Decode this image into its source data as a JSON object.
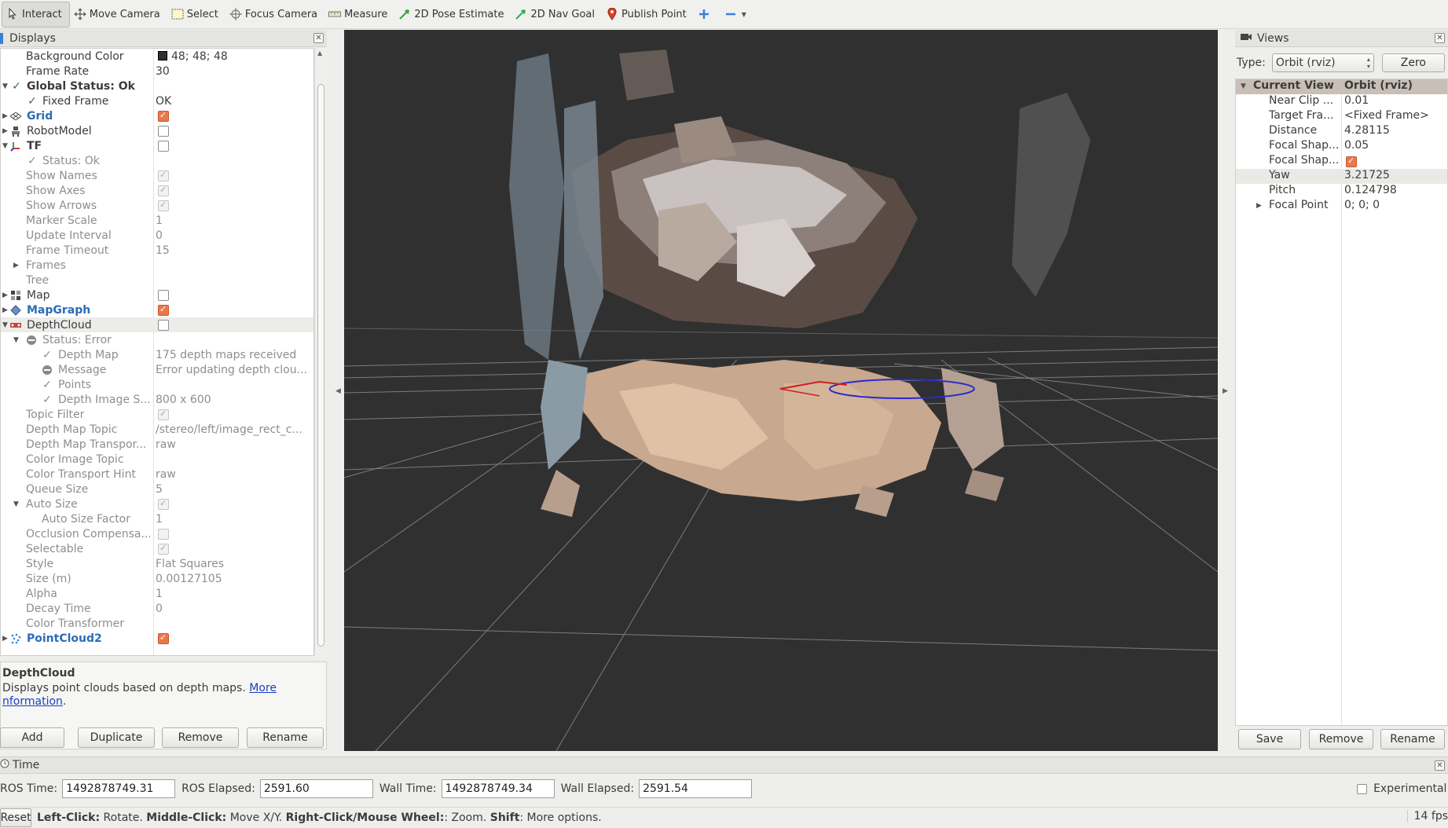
{
  "toolbar": {
    "tools": [
      {
        "label": "Interact",
        "icon": "cursor-icon"
      },
      {
        "label": "Move Camera",
        "icon": "move-camera-icon"
      },
      {
        "label": "Select",
        "icon": "select-icon"
      },
      {
        "label": "Focus Camera",
        "icon": "focus-camera-icon"
      },
      {
        "label": "Measure",
        "icon": "measure-icon"
      },
      {
        "label": "2D Pose Estimate",
        "icon": "pose-arrow-icon"
      },
      {
        "label": "2D Nav Goal",
        "icon": "nav-goal-icon"
      },
      {
        "label": "Publish Point",
        "icon": "map-pin-icon"
      }
    ]
  },
  "displays": {
    "title": "Displays",
    "rows": [
      {
        "label": "Background Color",
        "value": "48; 48; 48"
      },
      {
        "label": "Frame Rate",
        "value": "30"
      },
      {
        "label": "Global Status: Ok"
      },
      {
        "label": "Fixed Frame",
        "value": "OK"
      },
      {
        "label": "Grid"
      },
      {
        "label": "RobotModel"
      },
      {
        "label": "TF"
      },
      {
        "label": "Status: Ok"
      },
      {
        "label": "Show Names"
      },
      {
        "label": "Show Axes"
      },
      {
        "label": "Show Arrows"
      },
      {
        "label": "Marker Scale",
        "value": "1"
      },
      {
        "label": "Update Interval",
        "value": "0"
      },
      {
        "label": "Frame Timeout",
        "value": "15"
      },
      {
        "label": "Frames"
      },
      {
        "label": "Tree"
      },
      {
        "label": "Map"
      },
      {
        "label": "MapGraph"
      },
      {
        "label": "DepthCloud"
      },
      {
        "label": "Status: Error"
      },
      {
        "label": "Depth Map",
        "value": "175 depth maps received"
      },
      {
        "label": "Message",
        "value": "Error updating depth clou..."
      },
      {
        "label": "Points"
      },
      {
        "label": "Depth Image S...",
        "value": "800 x 600"
      },
      {
        "label": "Topic Filter"
      },
      {
        "label": "Depth Map Topic",
        "value": "/stereo/left/image_rect_c..."
      },
      {
        "label": "Depth Map Transpor...",
        "value": "raw"
      },
      {
        "label": "Color Image Topic"
      },
      {
        "label": "Color Transport Hint",
        "value": "raw"
      },
      {
        "label": "Queue Size",
        "value": "5"
      },
      {
        "label": "Auto Size"
      },
      {
        "label": "Auto Size Factor",
        "value": "1"
      },
      {
        "label": "Occlusion Compensa..."
      },
      {
        "label": "Selectable"
      },
      {
        "label": "Style",
        "value": "Flat Squares"
      },
      {
        "label": "Size (m)",
        "value": "0.00127105"
      },
      {
        "label": "Alpha",
        "value": "1"
      },
      {
        "label": "Decay Time",
        "value": "0"
      },
      {
        "label": "Color Transformer"
      },
      {
        "label": "PointCloud2"
      }
    ],
    "background_color_swatch": "#303030",
    "description": {
      "title": "DepthCloud",
      "text": "Displays point clouds based on depth maps. ",
      "link_part1": "More",
      "link_part2": "nformation",
      "link_trail": "."
    },
    "buttons": {
      "add": "Add",
      "duplicate": "Duplicate",
      "remove": "Remove",
      "rename": "Rename"
    }
  },
  "views": {
    "title": "Views",
    "type_label": "Type:",
    "type_value": "Orbit (rviz)",
    "zero_label": "Zero",
    "rows": [
      {
        "label": "Current View",
        "value": "Orbit (rviz)"
      },
      {
        "label": "Near Clip ...",
        "value": "0.01"
      },
      {
        "label": "Target Fra...",
        "value": "<Fixed Frame>"
      },
      {
        "label": "Distance",
        "value": "4.28115"
      },
      {
        "label": "Focal Shap...",
        "value": "0.05"
      },
      {
        "label": "Focal Shap..."
      },
      {
        "label": "Yaw",
        "value": "3.21725"
      },
      {
        "label": "Pitch",
        "value": "0.124798"
      },
      {
        "label": "Focal Point",
        "value": "0; 0; 0"
      }
    ],
    "buttons": {
      "save": "Save",
      "remove": "Remove",
      "rename": "Rename"
    }
  },
  "time": {
    "title": "Time",
    "ros_time_label": "ROS Time:",
    "ros_time": "1492878749.31",
    "ros_elapsed_label": "ROS Elapsed:",
    "ros_elapsed": "2591.60",
    "wall_time_label": "Wall Time:",
    "wall_time": "1492878749.34",
    "wall_elapsed_label": "Wall Elapsed:",
    "wall_elapsed": "2591.54",
    "experimental_label": "Experimental"
  },
  "status": {
    "reset": "Reset",
    "hint_b1": "Left-Click:",
    "hint_t1": " Rotate. ",
    "hint_b2": "Middle-Click:",
    "hint_t2": " Move X/Y. ",
    "hint_b3": "Right-Click/Mouse Wheel:",
    "hint_t3": ": Zoom. ",
    "hint_b4": "Shift",
    "hint_t4": ": More options.",
    "fps": "14 fps"
  },
  "colors": {
    "viewport_bg": "#303030",
    "checkbox_on": "#e9794b",
    "link": "#1a3fc2",
    "display_name_blue": "#2b6cb8"
  }
}
